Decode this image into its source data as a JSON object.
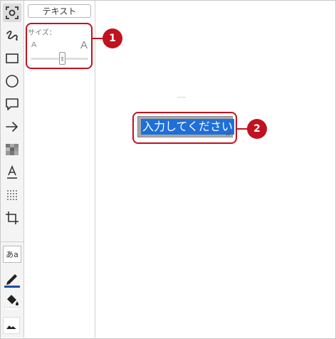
{
  "toolbar": {
    "tools": [
      {
        "name": "screenshot-capture-tool",
        "icon": "capture-icon",
        "selected": true
      },
      {
        "name": "freehand-pen-tool",
        "icon": "scribble-icon"
      },
      {
        "name": "rectangle-tool",
        "icon": "rectangle-icon"
      },
      {
        "name": "ellipse-tool",
        "icon": "circle-icon"
      },
      {
        "name": "speech-bubble-tool",
        "icon": "speech-bubble-icon"
      },
      {
        "name": "arrow-tool",
        "icon": "arrow-icon"
      },
      {
        "name": "mosaic-tool",
        "icon": "mosaic-icon"
      },
      {
        "name": "text-tool",
        "icon": "text-underline-icon"
      },
      {
        "name": "blur-tool",
        "icon": "blur-dots-icon"
      },
      {
        "name": "crop-tool",
        "icon": "crop-icon"
      }
    ],
    "font_button_label": "あa",
    "pen_color": "#1b4fa0",
    "fill_color": "#ffffff"
  },
  "panel": {
    "title": "テキスト",
    "size_label": "サイズ：",
    "size_small_glyph": "A",
    "size_large_glyph": "A",
    "slider_value_fraction": 0.55
  },
  "canvas": {
    "text_input_value": "入力してください"
  },
  "callouts": [
    {
      "number": "1",
      "color": "#c1121f"
    },
    {
      "number": "2",
      "color": "#c1121f"
    }
  ]
}
